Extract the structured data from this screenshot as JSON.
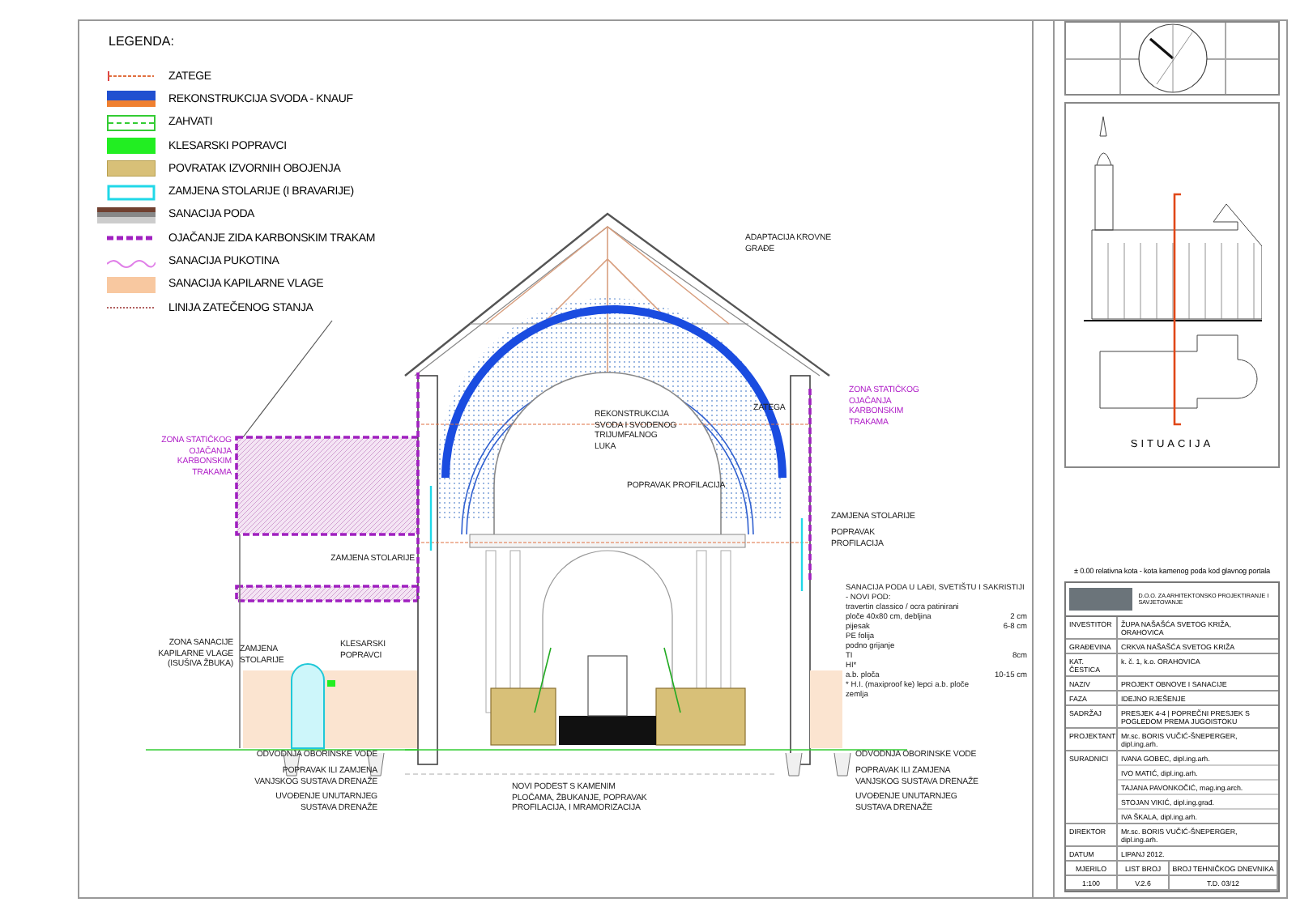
{
  "legend": {
    "title": "LEGENDA:",
    "items": [
      {
        "kind": "tie",
        "label": "ZATEGE"
      },
      {
        "kind": "vault",
        "label": "REKONSTRUKCIJA SVODA - KNAUF"
      },
      {
        "kind": "dashed-green",
        "label": "ZAHVATI"
      },
      {
        "kind": "solid-green",
        "label": "KLESARSKI POPRAVCI"
      },
      {
        "kind": "tan",
        "label": "POVRATAK IZVORNIH OBOJENJA"
      },
      {
        "kind": "cyan",
        "label": "ZAMJENA STOLARIJE (I BRAVARIJE)"
      },
      {
        "kind": "floor",
        "label": "SANACIJA PODA"
      },
      {
        "kind": "purple-dashed",
        "label": "OJAČANJE ZIDA KARBONSKIM TRAKAM"
      },
      {
        "kind": "wave",
        "label": "SANACIJA PUKOTINA"
      },
      {
        "kind": "peach",
        "label": "SANACIJA KAPILARNE VLAGE"
      },
      {
        "kind": "dotted",
        "label": "LINIJA ZATEČENOG STANJA"
      }
    ]
  },
  "annotations": [
    {
      "kind": "note",
      "lines": [
        "ADAPTACIJA KROVNE",
        "GRAĐE"
      ]
    },
    {
      "kind": "note",
      "lines": [
        "ZATEGA"
      ]
    },
    {
      "kind": "note",
      "lines": [
        "REKONSTRUKCIJA",
        "SVODA I SVODENOG",
        "TRIJUMFALNOG",
        "LUKA"
      ]
    },
    {
      "kind": "note",
      "lines": [
        "POPRAVAK PROFILACIJA"
      ]
    },
    {
      "kind": "zone",
      "lines": [
        "ZONA STATIČKOG",
        "OJAČANJA",
        "KARBONSKIM",
        "TRAKAMA"
      ]
    },
    {
      "kind": "zone",
      "lines": [
        "ZONA STATIČKOG",
        "OJAČANJA",
        "KARBONSKIM",
        "TRAKAMA"
      ]
    },
    {
      "kind": "note",
      "lines": [
        "ZAMJENA STOLARIJE"
      ]
    },
    {
      "kind": "note",
      "lines": [
        "POPRAVAK",
        "PROFILACIJA"
      ]
    },
    {
      "kind": "note",
      "lines": [
        "ZAMJENA STOLARIJE"
      ]
    },
    {
      "kind": "note",
      "lines": [
        "ZONA SANACIJE",
        "KAPILARNE VLAGE",
        "(ISUŠIVA ŽBUKA)"
      ]
    },
    {
      "kind": "note",
      "lines": [
        "ZAMJENA",
        "STOLARIJE"
      ]
    },
    {
      "kind": "note",
      "lines": [
        "KLESARSKI",
        "POPRAVCI"
      ]
    },
    {
      "kind": "note",
      "lines": [
        "ODVODNJA OBORINSKE VODE"
      ]
    },
    {
      "kind": "note",
      "lines": [
        "POPRAVAK ILI ZAMJENA",
        "VANJSKOG SUSTAVA DRENAŽE"
      ]
    },
    {
      "kind": "note",
      "lines": [
        "UVOĐENJE UNUTARNJEG",
        "SUSTAVA DRENAŽE"
      ]
    },
    {
      "kind": "note",
      "lines": [
        "NOVI PODEST S KAMENIM",
        "PLOČAMA, ŽBUKANJE, POPRAVAK",
        "PROFILACIJA, I MRAMORIZACIJA"
      ]
    },
    {
      "kind": "note",
      "lines": [
        "ODVODNJA OBORINSKE VODE"
      ]
    },
    {
      "kind": "note",
      "lines": [
        "POPRAVAK ILI ZAMJENA",
        "VANJSKOG SUSTAVA DRENAŽE"
      ]
    },
    {
      "kind": "note",
      "lines": [
        "UVOĐENJE UNUTARNJEG",
        "SUSTAVA DRENAŽE"
      ]
    }
  ],
  "floor_spec": {
    "title": "SANACIJA PODA U LAĐI, SVETIŠTU I SAKRISTIJI",
    "subtitle": "- NOVI POD:",
    "rows": [
      {
        "material": "travertin classico / ocra patinirani",
        "thickness": ""
      },
      {
        "material": "ploče 40x80 cm, debljina",
        "thickness": "2 cm"
      },
      {
        "material": "pijesak",
        "thickness": "6-8 cm"
      },
      {
        "material": "PE folija",
        "thickness": ""
      },
      {
        "material": "podno grijanje",
        "thickness": ""
      },
      {
        "material": "TI",
        "thickness": "8cm"
      },
      {
        "material": "HI*",
        "thickness": ""
      },
      {
        "material": "a.b. ploča",
        "thickness": "10-15 cm"
      },
      {
        "material": "* H.I. (maxiproof ke) lepci a.b. ploče",
        "thickness": ""
      },
      {
        "material": "zemlja",
        "thickness": ""
      }
    ]
  },
  "situation": {
    "title": "SITUACIJA"
  },
  "elevation_note": "± 0.00 relativna kota - kota kamenog poda kod glavnog portala",
  "title_block": {
    "company": "D.O.O. ZA ARHITEKTONSKO PROJEKTIRANJE I SAVJETOVANJE",
    "rows": [
      {
        "label": "INVESTITOR",
        "values": [
          "ŽUPA NAŠAŠĆA SVETOG KRIŽA, ORAHOVICA"
        ]
      },
      {
        "label": "GRAĐEVINA",
        "values": [
          "CRKVA NAŠAŠĆA SVETOG KRIŽA"
        ]
      },
      {
        "label": "KAT. ČESTICA",
        "values": [
          "k. č. 1, k.o. ORAHOVICA"
        ]
      },
      {
        "label": "NAZIV",
        "values": [
          "PROJEKT OBNOVE I SANACIJE"
        ]
      },
      {
        "label": "FAZA",
        "values": [
          "IDEJNO RJEŠENJE"
        ]
      },
      {
        "label": "SADRŽAJ",
        "values": [
          "PRESJEK 4-4 | POPREČNI PRESJEK S POGLEDOM PREMA JUGOISTOKU"
        ]
      },
      {
        "label": "PROJEKTANT",
        "values": [
          "Mr.sc. BORIS VUČIĆ-ŠNEPERGER, dipl.ing.arh."
        ]
      },
      {
        "label": "SURADNICI",
        "values": [
          "IVANA GOBEC, dipl.ing.arh.",
          "IVO MATIĆ, dipl.ing.arh.",
          "TAJANA PAVONKOČIĆ, mag.ing.arch.",
          "STOJAN VIKIĆ, dipl.ing.građ.",
          "IVA ŠKALA, dipl.ing.arh."
        ]
      },
      {
        "label": "DIREKTOR",
        "values": [
          "Mr.sc. BORIS VUČIĆ-ŠNEPERGER, dipl.ing.arh."
        ]
      },
      {
        "label": "DATUM",
        "values": [
          "LIPANJ 2012."
        ]
      }
    ],
    "footer": [
      {
        "label": "MJERILO",
        "value": "1:100"
      },
      {
        "label": "LIST BROJ",
        "value": "V.2.6"
      },
      {
        "label": "BROJ TEHNIČKOG DNEVNIKA",
        "value": "T.D. 03/12"
      }
    ]
  }
}
